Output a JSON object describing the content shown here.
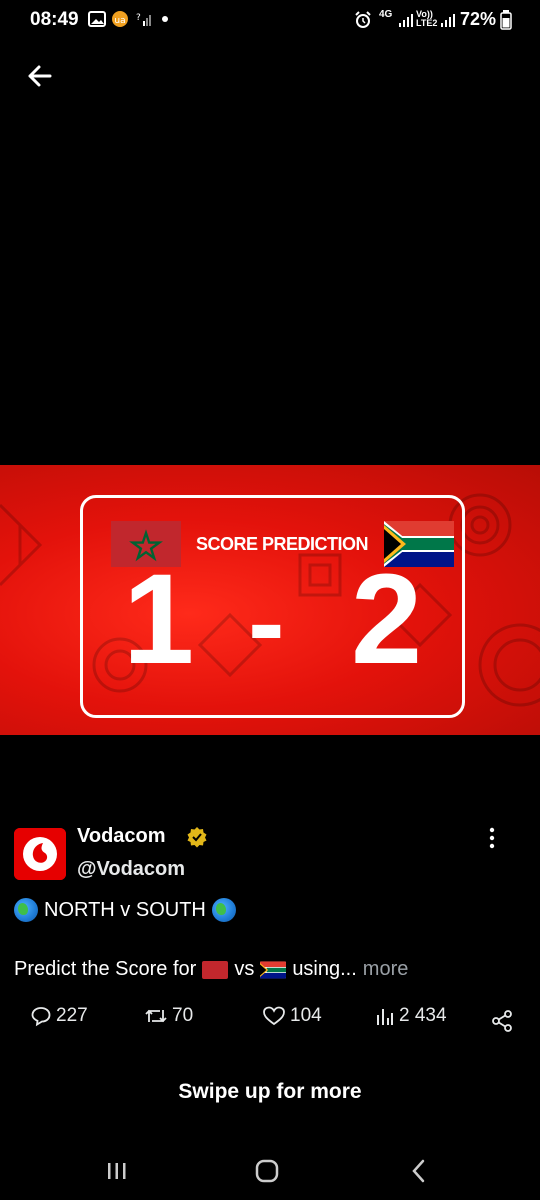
{
  "status": {
    "time": "08:49",
    "network_4g": "4G",
    "lte": "Vo)) LTE2",
    "battery": "72%"
  },
  "media": {
    "label": "SCORE PREDICTION",
    "home_score": "1",
    "dash": "-",
    "away_score": "2"
  },
  "tweet": {
    "name": "Vodacom",
    "handle": "@Vodacom",
    "line1_text": "NORTH v SOUTH",
    "line2_prefix": "Predict the Score for",
    "line2_vs": "vs",
    "line2_using": "using...",
    "more_label": "more"
  },
  "actions": {
    "replies": "227",
    "reposts": "70",
    "likes": "104",
    "views": "2 434"
  },
  "footer": {
    "swipe_label": "Swipe up for more"
  },
  "colors": {
    "brand_red": "#e60000",
    "verified_gold": "#e2b719"
  },
  "icons": [
    "back-arrow-icon",
    "verified-badge-icon",
    "more-vertical-icon",
    "reply-icon",
    "repost-icon",
    "like-icon",
    "views-icon",
    "share-icon",
    "recents-icon",
    "home-icon",
    "nav-back-icon"
  ]
}
